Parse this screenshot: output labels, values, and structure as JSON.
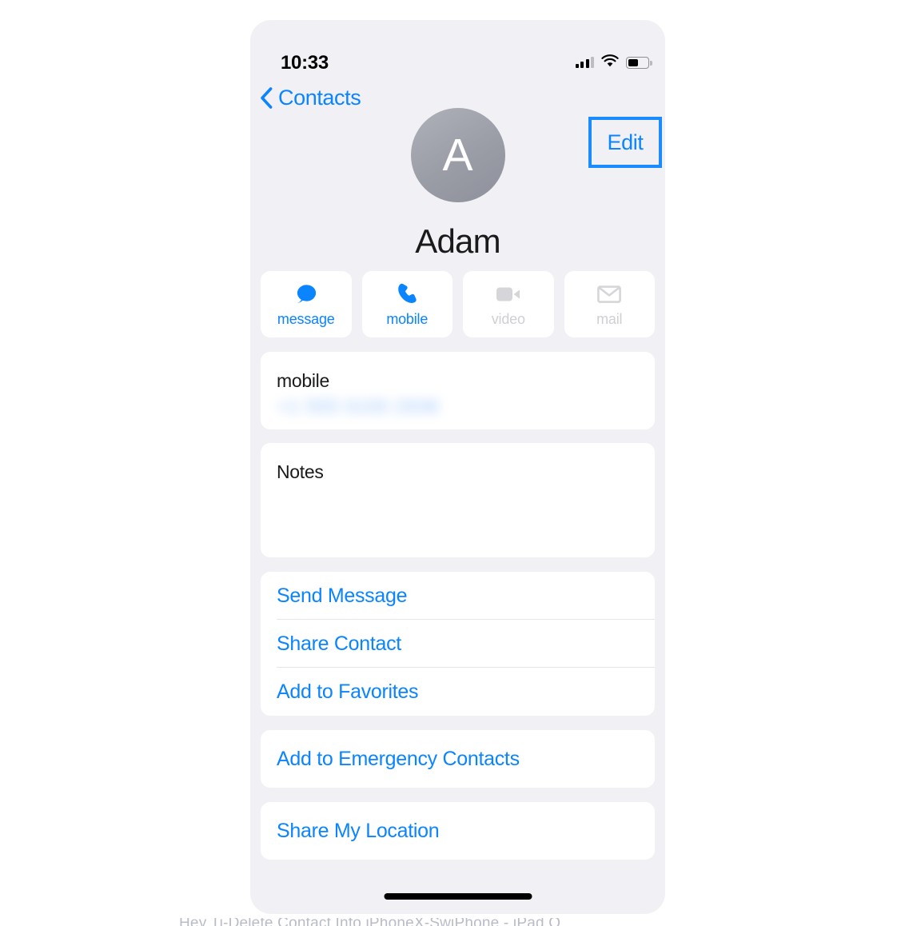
{
  "status_bar": {
    "time": "10:33",
    "signal_icon": "cellular-signal-icon",
    "signal_bars_total": 4,
    "signal_bars_filled": 3,
    "wifi_icon": "wifi-icon",
    "battery_icon": "battery-icon",
    "battery_level_percent": 45
  },
  "nav_bar": {
    "back_icon": "chevron-left-icon",
    "back_label": "Contacts",
    "edit_label": "Edit",
    "edit_highlight_color": "#1a8cff"
  },
  "contact": {
    "avatar_initial": "A",
    "name": "Adam"
  },
  "actions": [
    {
      "label": "message",
      "icon": "message-bubble-icon",
      "enabled": true
    },
    {
      "label": "mobile",
      "icon": "phone-handset-icon",
      "enabled": true
    },
    {
      "label": "video",
      "icon": "video-camera-icon",
      "enabled": false
    },
    {
      "label": "mail",
      "icon": "envelope-icon",
      "enabled": false
    }
  ],
  "phone_section": {
    "label": "mobile",
    "value_redacted": "+1 555 0100 2938",
    "value_is_blurred": true
  },
  "notes_section": {
    "label": "Notes",
    "value": ""
  },
  "link_groups": [
    {
      "items": [
        {
          "label": "Send Message"
        },
        {
          "label": "Share Contact"
        },
        {
          "label": "Add to Favorites"
        }
      ]
    },
    {
      "items": [
        {
          "label": "Add to Emergency Contacts"
        }
      ]
    },
    {
      "items": [
        {
          "label": "Share My Location"
        }
      ]
    }
  ],
  "home_indicator": "home-indicator",
  "caption": {
    "text": "Hey Ti-Delete Contact Info  iPhoneX-SwiPhone - iPad Q"
  },
  "colors": {
    "accent_blue": "#0a84ff",
    "highlight_blue": "#1a8cff",
    "screen_background": "#f1f1f5",
    "card_background": "#ffffff",
    "disabled_gray": "#cfcfd4",
    "primary_text": "#1a1a1a",
    "divider": "#e6e6ea"
  }
}
